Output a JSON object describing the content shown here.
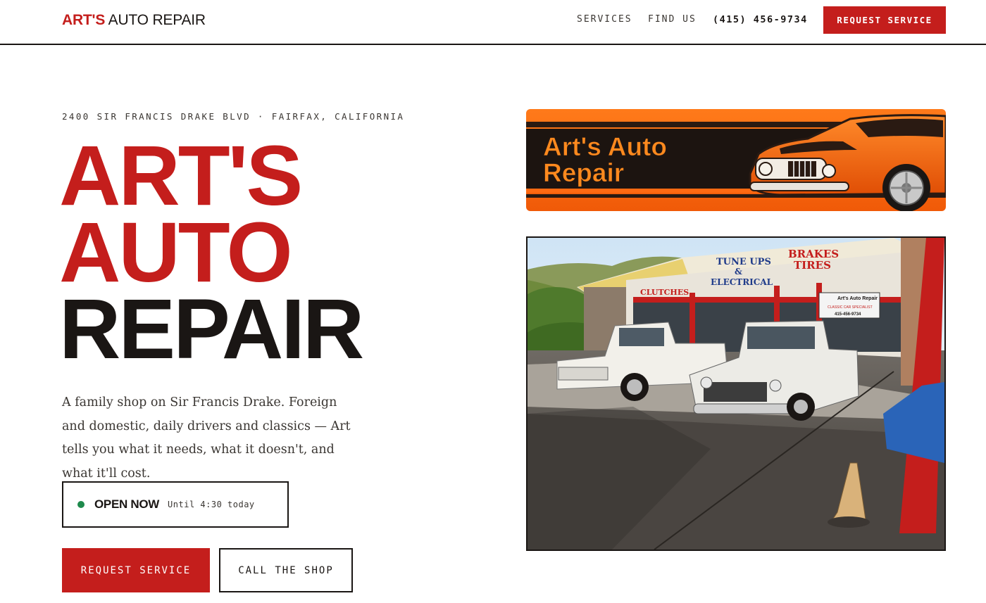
{
  "nav": {
    "logo_red": "ART'S",
    "logo_black": "AUTO REPAIR",
    "links": [
      "SERVICES",
      "FIND US"
    ],
    "phone": "(415) 456-9734",
    "cta": "REQUEST SERVICE"
  },
  "hero": {
    "address": "2400 SIR FRANCIS DRAKE BLVD · FAIRFAX, CALIFORNIA",
    "headline": [
      "ART'S",
      "AUTO",
      "REPAIR"
    ],
    "lede": "A family shop on Sir Francis Drake. Foreign and domestic, daily drivers and classics — Art tells you what it needs, what it doesn't, and what it'll cost.",
    "status": {
      "label": "OPEN NOW",
      "until": "Until 4:30 today",
      "color": "#1e8a4c"
    },
    "primary_button": "REQUEST SERVICE",
    "secondary_button": "CALL THE SHOP"
  },
  "banner": {
    "line1": "Art's Auto",
    "line2": "Repair"
  },
  "photo": {
    "sign_clutches": "CLUTCHES",
    "sign_tuneups": "TUNE UPS",
    "sign_amp": "&",
    "sign_electrical": "ELECTRICAL",
    "sign_brakes": "BRAKES",
    "sign_tires": "TIRES",
    "sign_shop_name": "Art's Auto Repair",
    "sign_specialist": "CLASSIC CAR SPECIALIST",
    "sign_phone": "415-456-9734"
  },
  "colors": {
    "brand_red": "#c41e1c",
    "ink": "#1a1614",
    "banner_orange": "#ff6a12",
    "status_green": "#1e8a4c"
  }
}
